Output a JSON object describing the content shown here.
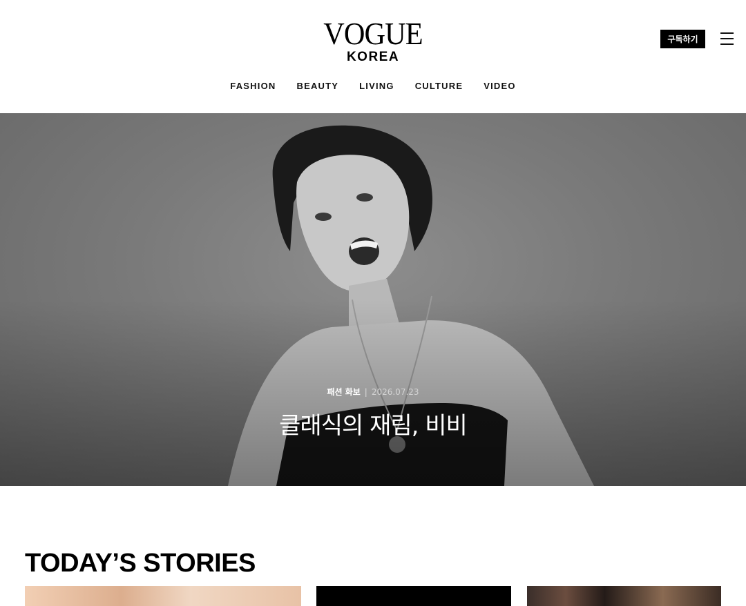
{
  "brand": {
    "logo_main": "VOGUE",
    "logo_sub": "KOREA"
  },
  "header": {
    "subscribe_label": "구독하기",
    "menu_icon": "hamburger-menu-icon"
  },
  "nav": {
    "items": [
      {
        "label": "FASHION"
      },
      {
        "label": "BEAUTY"
      },
      {
        "label": "LIVING"
      },
      {
        "label": "CULTURE"
      },
      {
        "label": "VIDEO"
      }
    ]
  },
  "hero": {
    "category": "패션 화보",
    "separator": "|",
    "date": "2026.07.23",
    "title": "클래식의 재림, 비비"
  },
  "today": {
    "title": "TODAY’S STORIES"
  },
  "colors": {
    "accent": "#000000",
    "background": "#ffffff"
  }
}
